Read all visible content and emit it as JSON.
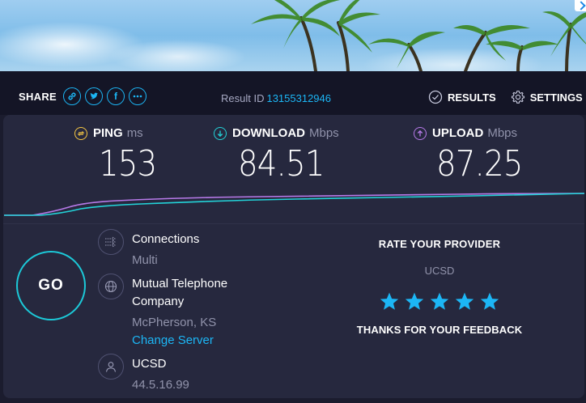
{
  "share": {
    "label": "SHARE",
    "icons": [
      "link-icon",
      "twitter-icon",
      "facebook-icon",
      "more-icon"
    ]
  },
  "result": {
    "label": "Result ID",
    "id": "13155312946"
  },
  "nav": {
    "results": "RESULTS",
    "settings": "SETTINGS"
  },
  "metrics": {
    "ping": {
      "label": "PING",
      "unit": "ms",
      "value": "153",
      "color": "#f6c744"
    },
    "download": {
      "label": "DOWNLOAD",
      "unit": "Mbps",
      "value": "84.51",
      "color": "#23d3d8"
    },
    "upload": {
      "label": "UPLOAD",
      "unit": "Mbps",
      "value": "87.25",
      "color": "#b77ae9"
    }
  },
  "go": {
    "label": "GO"
  },
  "connections": {
    "title": "Connections",
    "value": "Multi"
  },
  "server": {
    "name_line1": "Mutual Telephone",
    "name_line2": "Company",
    "location": "McPherson, KS",
    "change": "Change Server"
  },
  "host": {
    "name": "UCSD",
    "ip": "44.5.16.99"
  },
  "rating": {
    "title": "RATE YOUR PROVIDER",
    "provider": "UCSD",
    "stars": 5,
    "star_color": "#1cb6f5",
    "thanks": "THANKS FOR YOUR FEEDBACK"
  },
  "colors": {
    "accent": "#1cb6f5",
    "panel": "#26283e",
    "background": "#1b1c2e"
  }
}
